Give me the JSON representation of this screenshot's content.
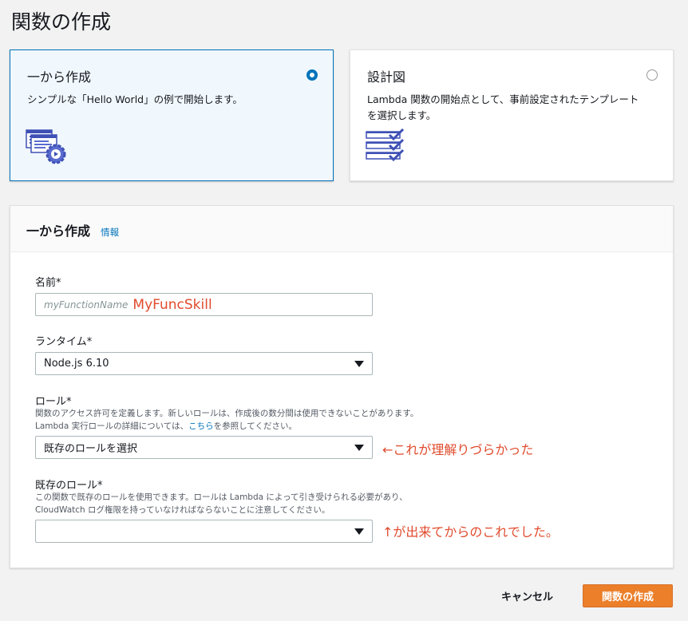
{
  "page": {
    "title": "関数の作成"
  },
  "tiles": [
    {
      "title": "一から作成",
      "description": "シンプルな「Hello World」の例で開始します。",
      "selected": true,
      "icon": "code-gear-icon"
    },
    {
      "title": "設計図",
      "description_line1": "Lambda 関数の開始点として、事前設定されたテンプレート",
      "description_line2": "を選択します。",
      "selected": false,
      "icon": "checklist-icon"
    }
  ],
  "panel": {
    "title": "一から作成",
    "info_link": "情報",
    "name": {
      "label": "名前*",
      "placeholder": "myFunctionName",
      "value": "MyFuncSkill"
    },
    "runtime": {
      "label": "ランタイム*",
      "selected": "Node.js 6.10"
    },
    "role": {
      "label": "ロール*",
      "help_line1": "関数のアクセス許可を定義します。新しいロールは、作成後の数分間は使用できないことがあります。",
      "help_line2_pre": "Lambda 実行ロールの詳細については、",
      "help_link": "こちら",
      "help_line2_post": "を参照してください。",
      "selected": "既存のロールを選択",
      "annotation": "←これが理解りづらかった"
    },
    "existing_role": {
      "label": "既存のロール*",
      "help_line1": "この関数で既存のロールを使用できます。ロールは Lambda によって引き受けられる必要があり、",
      "help_line2": "CloudWatch ログ権限を持っていなければならないことに注意してください。",
      "selected": "",
      "annotation": "↑が出来てからのこれでした。"
    }
  },
  "footer": {
    "cancel_label": "キャンセル",
    "create_label": "関数の作成"
  },
  "colors": {
    "accent": "#0073bb",
    "primary_button": "#eb7f2a",
    "annotation": "#e04b2d"
  }
}
